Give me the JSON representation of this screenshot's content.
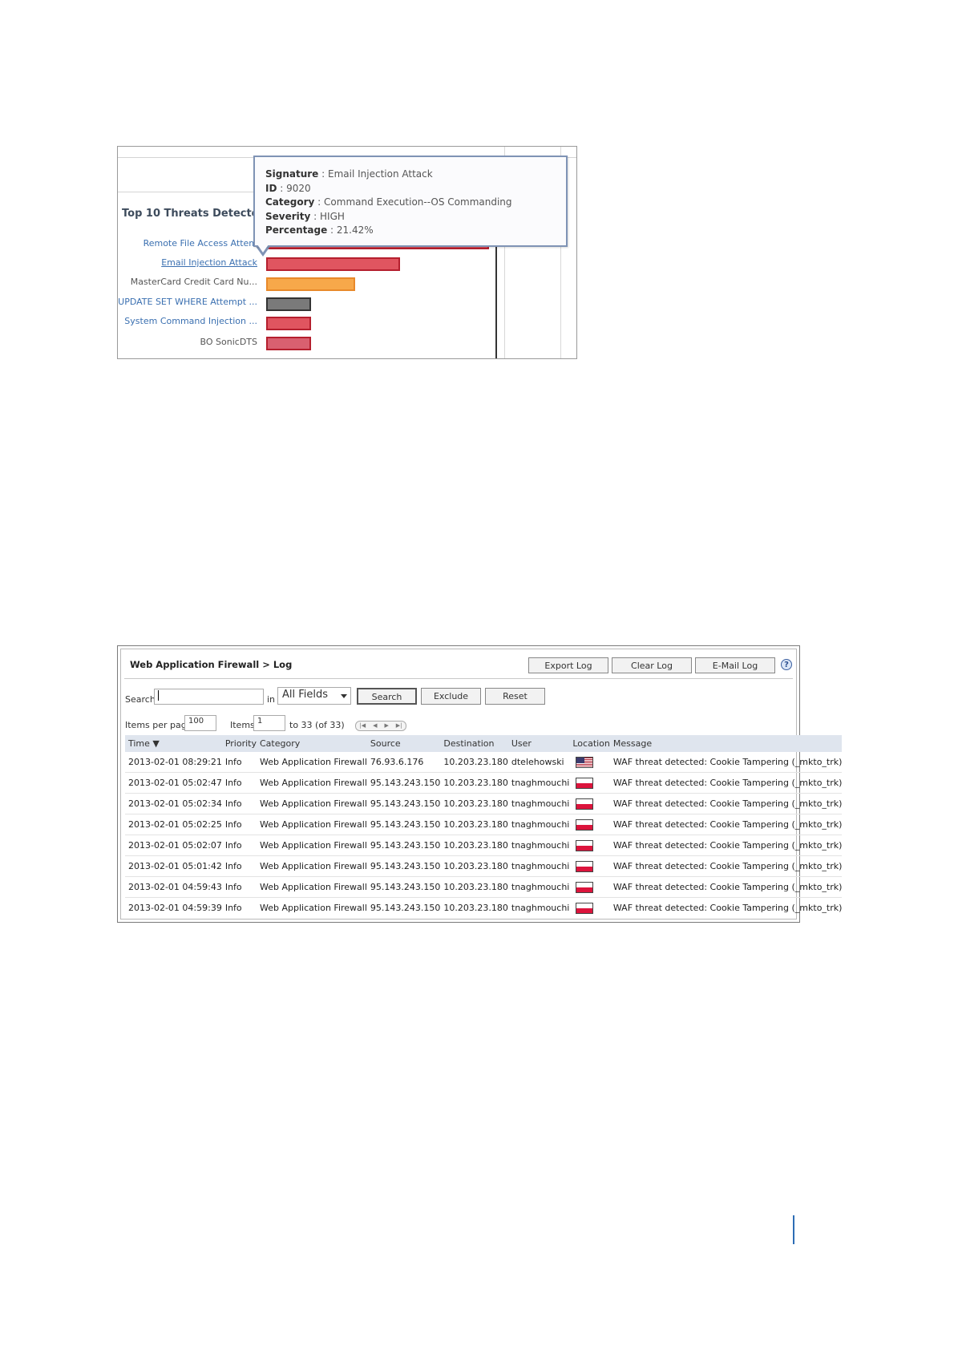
{
  "threats_panel": {
    "title": "Top 10 Threats Detected",
    "labels": [
      "Remote File Access Attem",
      "Email Injection Attack",
      "MasterCard Credit Card Nu...",
      "UPDATE SET WHERE Attempt ...",
      "System Command Injection ...",
      "BO SonicDTS"
    ],
    "tooltip": {
      "signature_key": "Signature",
      "signature_value": "Email Injection Attack",
      "id_key": "ID",
      "id_value": "9020",
      "category_key": "Category",
      "category_value": "Command Execution--OS Commanding",
      "severity_key": "Severity",
      "severity_value": "HIGH",
      "percentage_key": "Percentage",
      "percentage_value": "21.42%"
    },
    "bar_colors": [
      "#e05560",
      "#e05560",
      "#f7a84a",
      "#7a7a7a",
      "#e05560",
      "#d96070"
    ],
    "bar_relative_lengths": [
      1.0,
      0.6,
      0.4,
      0.2,
      0.2,
      0.2
    ]
  },
  "log_panel": {
    "title": "Web Application Firewall > Log",
    "toolbar": {
      "export_label": "Export Log",
      "clear_label": "Clear Log",
      "email_label": "E-Mail Log",
      "help_glyph": "?"
    },
    "search": {
      "label": "Search",
      "value": "",
      "in_label": "in",
      "field_selected": "All Fields",
      "search_button": "Search",
      "exclude_button": "Exclude",
      "reset_button": "Reset"
    },
    "paging": {
      "items_per_page_label": "Items per page",
      "items_per_page_value": "100",
      "items_label": "Items",
      "items_start_value": "1",
      "range_text": "to 33 (of 33)"
    },
    "columns": [
      "Time ▼",
      "Priority",
      "Category",
      "Source",
      "Destination",
      "User",
      "Location",
      "Message"
    ],
    "rows": [
      {
        "time": "2013-02-01 08:29:21",
        "priority": "Info",
        "category": "Web Application Firewall",
        "source": "76.93.6.176",
        "destination": "10.203.23.180",
        "user": "dtelehowski",
        "location": "us-flag",
        "message": "WAF threat detected: Cookie Tampering (_mkto_trk)"
      },
      {
        "time": "2013-02-01 05:02:47",
        "priority": "Info",
        "category": "Web Application Firewall",
        "source": "95.143.243.150",
        "destination": "10.203.23.180",
        "user": "tnaghmouchi",
        "location": "red-white-flag",
        "message": "WAF threat detected: Cookie Tampering (_mkto_trk)"
      },
      {
        "time": "2013-02-01 05:02:34",
        "priority": "Info",
        "category": "Web Application Firewall",
        "source": "95.143.243.150",
        "destination": "10.203.23.180",
        "user": "tnaghmouchi",
        "location": "red-white-flag",
        "message": "WAF threat detected: Cookie Tampering (_mkto_trk)"
      },
      {
        "time": "2013-02-01 05:02:25",
        "priority": "Info",
        "category": "Web Application Firewall",
        "source": "95.143.243.150",
        "destination": "10.203.23.180",
        "user": "tnaghmouchi",
        "location": "red-white-flag",
        "message": "WAF threat detected: Cookie Tampering (_mkto_trk)"
      },
      {
        "time": "2013-02-01 05:02:07",
        "priority": "Info",
        "category": "Web Application Firewall",
        "source": "95.143.243.150",
        "destination": "10.203.23.180",
        "user": "tnaghmouchi",
        "location": "red-white-flag",
        "message": "WAF threat detected: Cookie Tampering (_mkto_trk)"
      },
      {
        "time": "2013-02-01 05:01:42",
        "priority": "Info",
        "category": "Web Application Firewall",
        "source": "95.143.243.150",
        "destination": "10.203.23.180",
        "user": "tnaghmouchi",
        "location": "red-white-flag",
        "message": "WAF threat detected: Cookie Tampering (_mkto_trk)"
      },
      {
        "time": "2013-02-01 04:59:43",
        "priority": "Info",
        "category": "Web Application Firewall",
        "source": "95.143.243.150",
        "destination": "10.203.23.180",
        "user": "tnaghmouchi",
        "location": "red-white-flag",
        "message": "WAF threat detected: Cookie Tampering (_mkto_trk)"
      },
      {
        "time": "2013-02-01 04:59:39",
        "priority": "Info",
        "category": "Web Application Firewall",
        "source": "95.143.243.150",
        "destination": "10.203.23.180",
        "user": "tnaghmouchi",
        "location": "red-white-flag",
        "message": "WAF threat detected: Cookie Tampering (_mkto_trk)"
      }
    ]
  }
}
